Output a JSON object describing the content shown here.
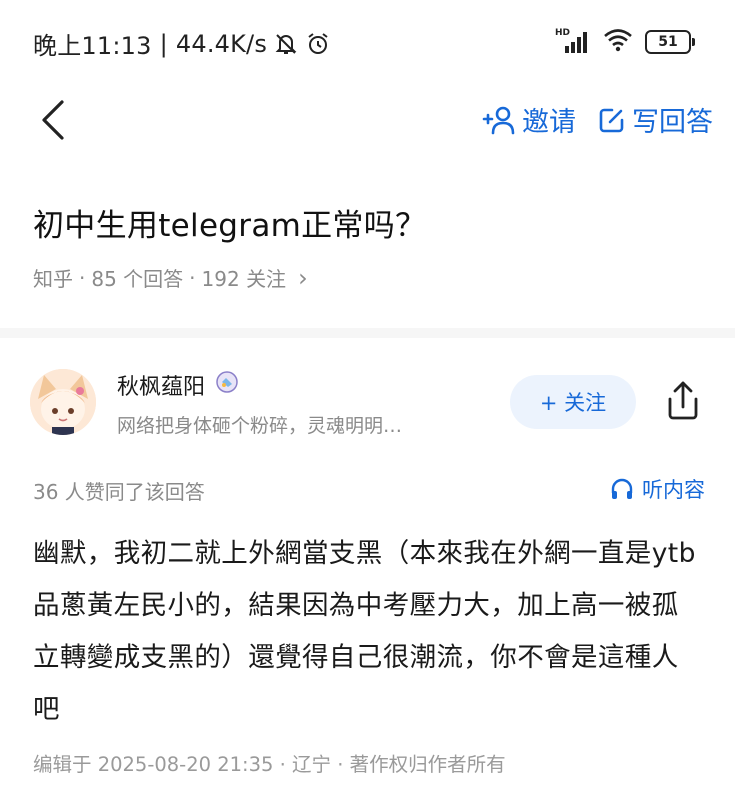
{
  "status_bar": {
    "time": "晚上11:13",
    "network_speed": "44.4K/s",
    "battery": "51",
    "signal_label": "HD",
    "icons": [
      "mute-bell-icon",
      "alarm-icon",
      "signal-icon",
      "wifi-icon",
      "battery-icon"
    ]
  },
  "nav": {
    "invite_label": "邀请",
    "write_answer_label": "写回答",
    "icons": [
      "back-arrow-icon",
      "add-user-icon",
      "edit-icon"
    ]
  },
  "question": {
    "title": "初中生用telegram正常吗？",
    "source": "知乎",
    "separator": "·",
    "answers_count": "85 个回答",
    "followers_count": "192 关注",
    "chevron": "›"
  },
  "answer": {
    "author": {
      "name": "秋枫蕴阳",
      "bio": "网络把身体砸个粉碎，灵魂明明…",
      "follow_label": "+ 关注"
    },
    "votes_text": "36 人赞同了该回答",
    "listen_label": "听内容",
    "paragraph": "幽默，我初二就上外網當支黑（本來我在外網一直是ytb品蔥黃左民小的，結果因為中考壓力大，加上高一被孤立轉變成支黑的）還覺得自己很潮流，你不會是這種人吧",
    "footer": "编辑于 2025-08-20 21:35 · 辽宁 · 著作权归作者所有"
  },
  "colors": {
    "accent": "#1769d8",
    "muted_text": "#8a8a8a",
    "follow_bg": "#ecf3fd"
  }
}
